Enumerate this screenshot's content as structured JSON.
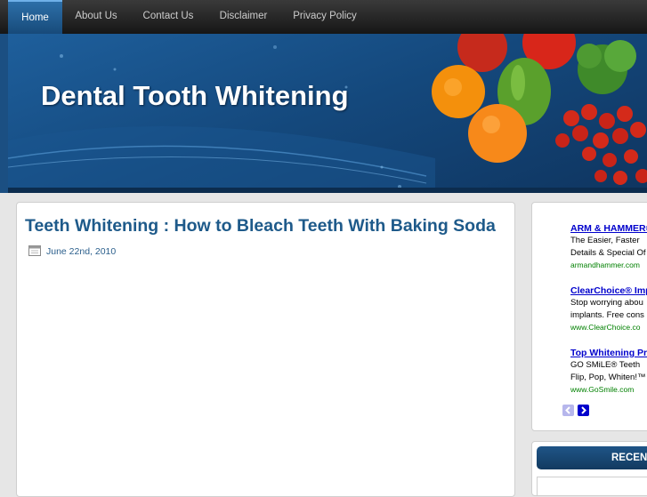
{
  "nav": {
    "items": [
      "Home",
      "About Us",
      "Contact Us",
      "Disclaimer",
      "Privacy Policy"
    ]
  },
  "header": {
    "site_title": "Dental Tooth Whitening"
  },
  "post": {
    "title": "Teeth Whitening : How to Bleach Teeth With Baking Soda",
    "date": "June 22nd, 2010"
  },
  "sidebar": {
    "ads": [
      {
        "title": "ARM & HAMMER®",
        "line1": "The Easier, Faster",
        "line2": "Details & Special Of",
        "url": "armandhammer.com"
      },
      {
        "title": "ClearChoice® Imp",
        "line1": "Stop worrying abou",
        "line2": "implants. Free cons",
        "url": "www.ClearChoice.co"
      },
      {
        "title": "Top Whitening Pro",
        "line1": "GO SMiLE® Teeth",
        "line2": "Flip, Pop, Whiten!™",
        "url": "www.GoSmile.com"
      }
    ],
    "recent_heading": "RECENT"
  },
  "colors": {
    "accent": "#1e5a8a",
    "nav_active": "#2d6fa8",
    "ad_link": "#0000cc",
    "ad_url": "#008000"
  }
}
